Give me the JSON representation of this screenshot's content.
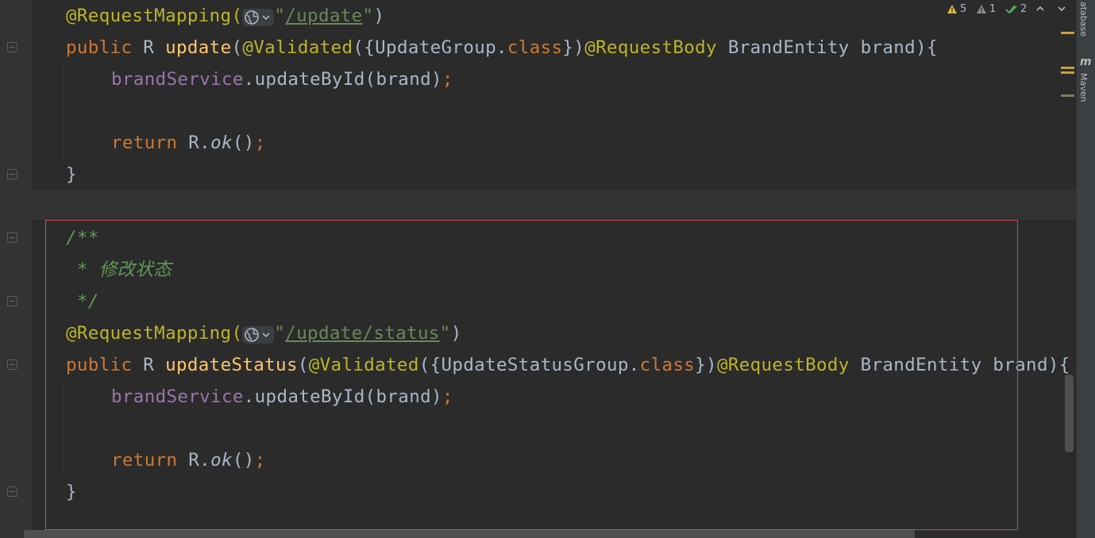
{
  "editor": {
    "method1": {
      "annotation": "@RequestMapping(",
      "path_open_quote": "\"",
      "path": "/update",
      "path_close_quote": "\"",
      "annotation_close": ")",
      "kw_public": "public",
      "ret_type": " R ",
      "name": "update",
      "params_open": "(",
      "validated": "@Validated",
      "group_open": "({UpdateGroup.",
      "class_kw": "class",
      "group_close": "})",
      "request_body": "@RequestBody",
      "params_rest": " BrandEntity brand){",
      "body_field": "brandService",
      "body_call": ".updateById(brand)",
      "semicolon": ";",
      "return_kw": "return",
      "return_obj": " R.",
      "return_method": "ok",
      "return_tail": "()",
      "return_semicolon": ";",
      "close_brace": "}"
    },
    "comment": {
      "open": "/**",
      "text": " * 修改状态",
      "close": " */"
    },
    "method2": {
      "annotation": "@RequestMapping(",
      "path_open_quote": "\"",
      "path": "/update/status",
      "path_close_quote": "\"",
      "annotation_close": ")",
      "kw_public": "public",
      "ret_type": " R ",
      "name": "updateStatus",
      "params_open": "(",
      "validated": "@Validated",
      "group_open": "({UpdateStatusGroup.",
      "class_kw": "class",
      "group_close": "})",
      "request_body": "@RequestBody",
      "params_rest": " BrandEntity brand){",
      "body_field": "brandService",
      "body_call": ".updateById(brand)",
      "semicolon": ";",
      "return_kw": "return",
      "return_obj": " R.",
      "return_method": "ok",
      "return_tail": "()",
      "return_semicolon": ";",
      "close_brace": "}"
    }
  },
  "inspections": {
    "warnings": "5",
    "weak_warnings": "1",
    "typos": "2"
  },
  "right_toolbar": {
    "database_label": "atabase",
    "maven_label": "Maven"
  },
  "icons": {
    "globe": "globe-icon",
    "dropdown": "chevron-down-icon",
    "warning": "warning-icon",
    "weak_warning": "weak-warning-icon",
    "typo": "double-check-icon",
    "prev": "chevron-up-icon",
    "next": "chevron-down-icon",
    "maven": "maven-icon"
  },
  "colors": {
    "background": "#2b2b2b",
    "selection_border": "#e04545",
    "annotation": "#bbb529",
    "keyword": "#cc7832",
    "method": "#ffc66d",
    "string": "#6a8759",
    "field": "#9876aa",
    "comment": "#629755"
  }
}
